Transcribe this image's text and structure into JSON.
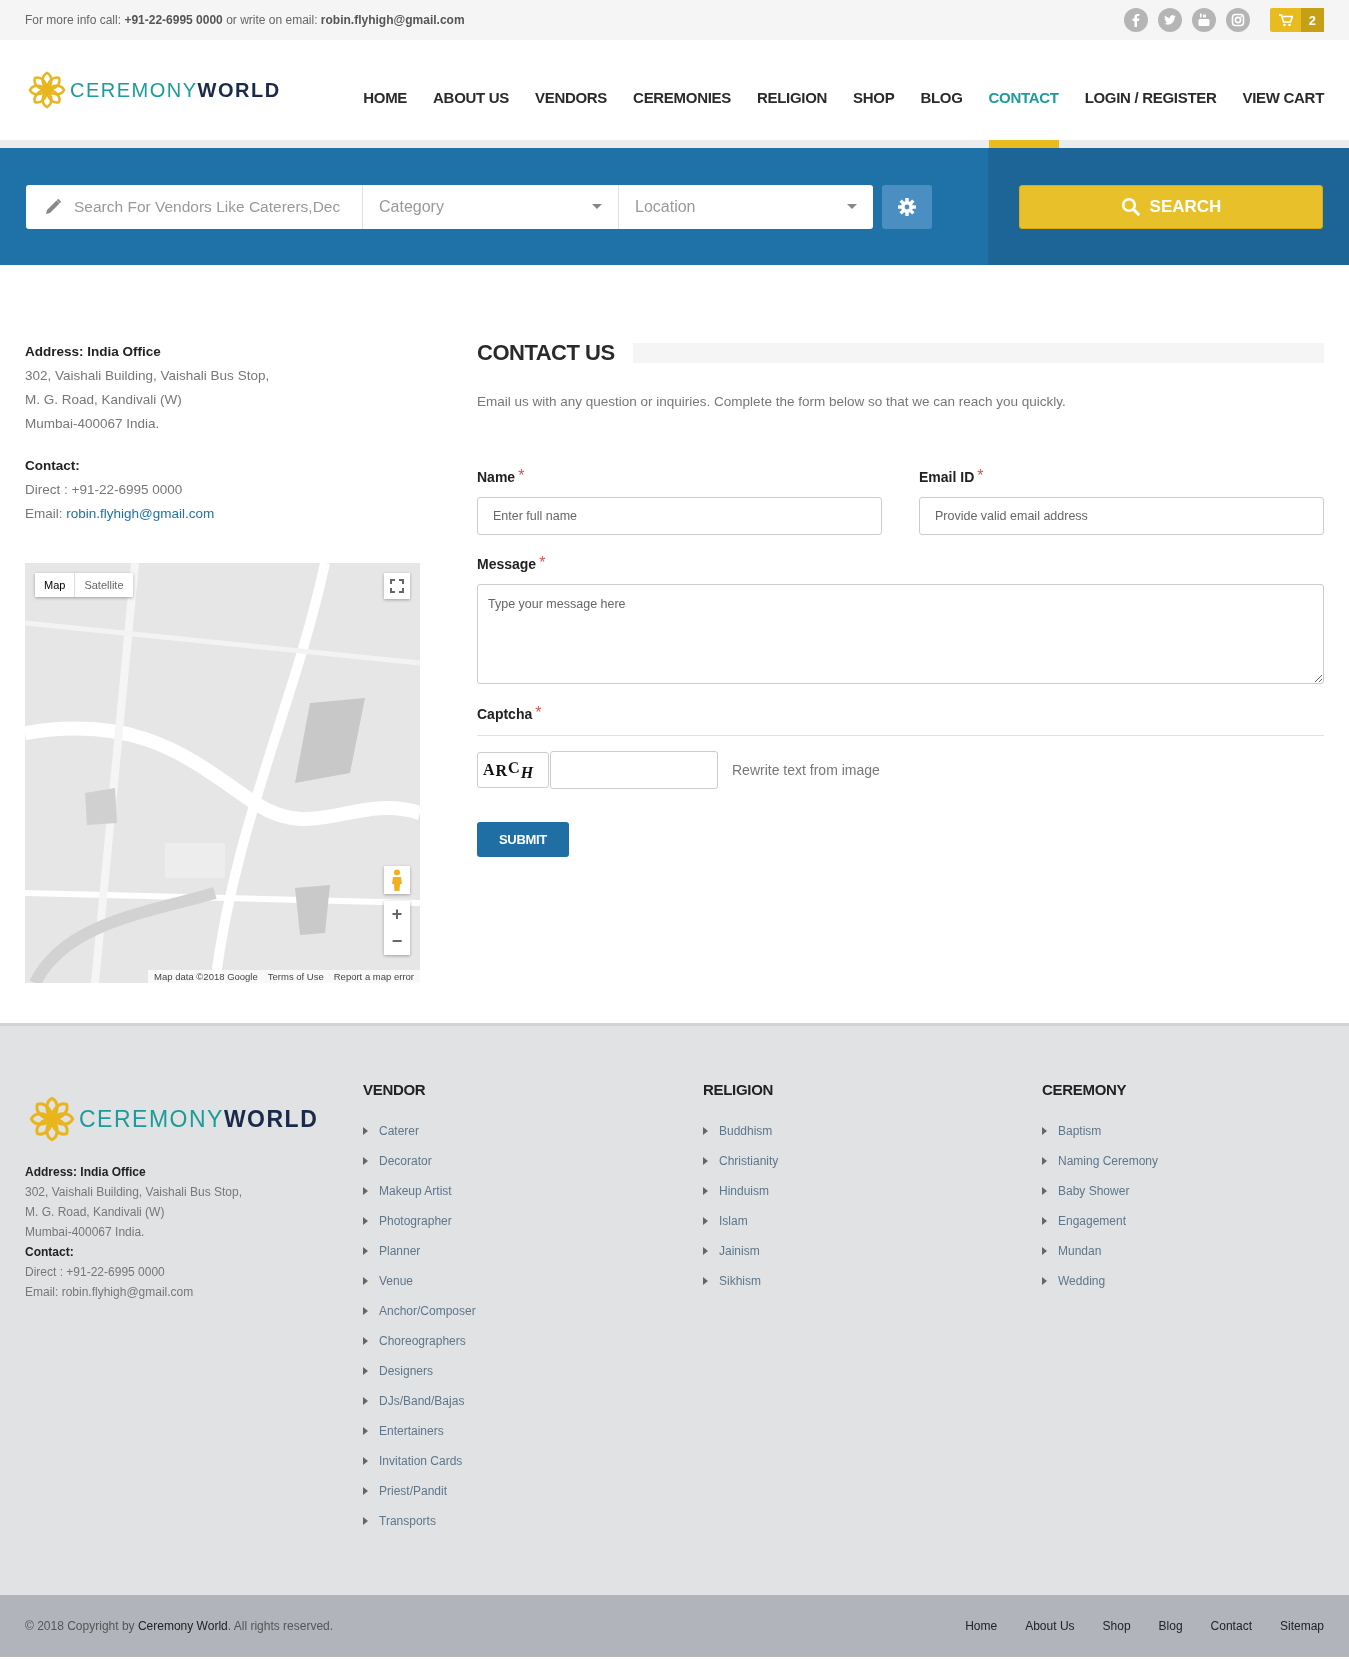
{
  "topbar": {
    "info": "For more info call: **+91-22-6995 0000** or write on email: **robin.flyhigh@gmail.com**",
    "social": [
      {
        "kind": "facebook"
      },
      {
        "kind": "twitter"
      },
      {
        "kind": "youtube"
      },
      {
        "kind": "instagram"
      }
    ],
    "cart_count": "2"
  },
  "header": {
    "logo": {
      "first": "CEREMONY",
      "second": "WORLD"
    },
    "nav": [
      {
        "label": "HOME",
        "selected": false
      },
      {
        "label": "ABOUT US",
        "selected": false
      },
      {
        "label": "VENDORS",
        "selected": false
      },
      {
        "label": "CEREMONIES",
        "selected": false
      },
      {
        "label": "RELIGION",
        "selected": false
      },
      {
        "label": "SHOP",
        "selected": false
      },
      {
        "label": "BLOG",
        "selected": false
      },
      {
        "label": "CONTACT",
        "selected": true
      },
      {
        "label": "LOGIN / REGISTER",
        "selected": false
      },
      {
        "label": "VIEW CART",
        "selected": false
      }
    ]
  },
  "search": {
    "placeholder": "Search For Vendors Like Caterers,Dec",
    "category": "Category",
    "location": "Location",
    "button": "SEARCH"
  },
  "contact_info": {
    "address_heading": "Address: India Office",
    "address_lines": [
      "302, Vaishali Building, Vaishali Bus Stop,",
      "M. G. Road, Kandivali (W)",
      "Mumbai-400067 India."
    ],
    "contact_heading": "Contact:",
    "direct": "Direct : +91-22-6995 0000",
    "email_label": "Email:",
    "email": "robin.flyhigh@gmail.com"
  },
  "map": {
    "map_types": [
      {
        "label": "Map",
        "selected": true
      },
      {
        "label": "Satellite",
        "selected": false
      }
    ],
    "zoom_in": "+",
    "zoom_out": "−",
    "attribution": [
      "Map data ©2018 Google",
      "Terms of Use",
      "Report a map error"
    ]
  },
  "contact_form": {
    "title": "CONTACT US",
    "intro": "Email us with any question or inquiries. Complete the form below so that we can reach you quickly.",
    "fields": [
      {
        "kind": "input",
        "label": "Name",
        "mark": "*",
        "placeholder": "Enter full name"
      },
      {
        "kind": "input",
        "label": "Email ID",
        "mark": "*",
        "placeholder": "Provide valid email address"
      },
      {
        "kind": "textarea",
        "label": "Message",
        "mark": "*",
        "placeholder": "Type your message here"
      }
    ],
    "captcha": {
      "label": "Captcha",
      "mark": "*",
      "image_text": "ARCH",
      "hint": "Rewrite text from image"
    },
    "submit": "SUBMIT"
  },
  "footer": {
    "logo": {
      "first": "CEREMONY",
      "second": "WORLD"
    },
    "address_heading": "Address: India Office",
    "address_lines": [
      "302, Vaishali Building, Vaishali Bus Stop,",
      "M. G. Road, Kandivali (W)",
      "Mumbai-400067 India."
    ],
    "contact_heading": "Contact:",
    "direct": "Direct : +91-22-6995 0000",
    "email": "Email: robin.flyhigh@gmail.com",
    "columns": [
      {
        "title": "VENDOR",
        "items": [
          "Caterer",
          "Decorator",
          "Makeup Artist",
          "Photographer",
          "Planner",
          "Venue",
          "Anchor/Composer",
          "Choreographers",
          "Designers",
          "DJs/Band/Bajas",
          "Entertainers",
          "Invitation Cards",
          "Priest/Pandit",
          "Transports"
        ]
      },
      {
        "title": "RELIGION",
        "items": [
          "Buddhism",
          "Christianity",
          "Hinduism",
          "Islam",
          "Jainism",
          "Sikhism"
        ]
      },
      {
        "title": "CEREMONY",
        "items": [
          "Baptism",
          "Naming Ceremony",
          "Baby Shower",
          "Engagement",
          "Mundan",
          "Wedding"
        ]
      }
    ]
  },
  "bottom_bar": {
    "copyright_prefix": "© 2018 Copyright by",
    "copyright_link": "Ceremony World",
    "copyright_suffix": ". All rights reserved.",
    "links": [
      "Home",
      "About Us",
      "Shop",
      "Blog",
      "Contact",
      "Sitemap"
    ]
  }
}
